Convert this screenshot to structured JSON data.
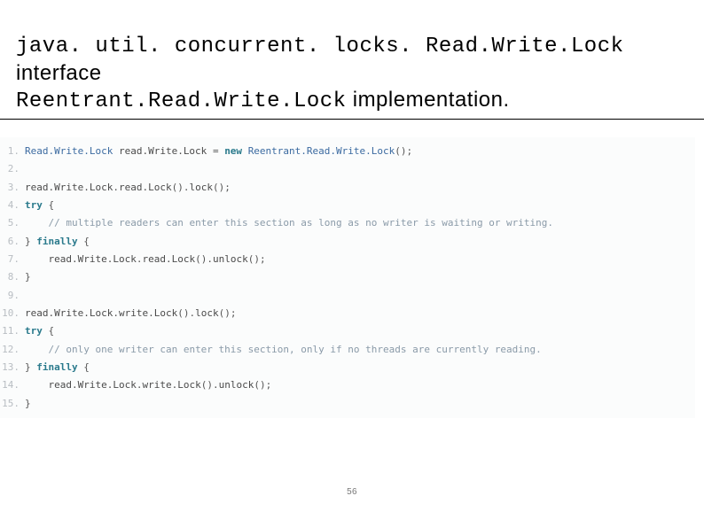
{
  "header": {
    "line1_mono": "java. util. concurrent. locks. Read.Write.Lock",
    "line1_tail": " interface",
    "line2_mono": "Reentrant.Read.Write.Lock",
    "line2_tail": " implementation."
  },
  "code": {
    "lines": [
      {
        "n": "1.",
        "segs": [
          {
            "t": "Read.Write.Lock",
            "c": "tok-type"
          },
          {
            "t": " read.Write.Lock "
          },
          {
            "t": "=",
            "c": "tok-punc"
          },
          {
            "t": " "
          },
          {
            "t": "new",
            "c": "tok-kw"
          },
          {
            "t": " "
          },
          {
            "t": "Reentrant.Read.Write.Lock",
            "c": "tok-type"
          },
          {
            "t": "();",
            "c": "tok-punc"
          }
        ]
      },
      {
        "n": "2.",
        "segs": [
          {
            "t": ""
          }
        ]
      },
      {
        "n": "3.",
        "segs": [
          {
            "t": "read.Write.Lock"
          },
          {
            "t": ".",
            "c": "tok-punc"
          },
          {
            "t": "read.Lock"
          },
          {
            "t": "().",
            "c": "tok-punc"
          },
          {
            "t": "lock"
          },
          {
            "t": "();",
            "c": "tok-punc"
          }
        ]
      },
      {
        "n": "4.",
        "segs": [
          {
            "t": "try",
            "c": "tok-kw"
          },
          {
            "t": " "
          },
          {
            "t": "{",
            "c": "tok-punc"
          }
        ]
      },
      {
        "n": "5.",
        "segs": [
          {
            "t": "    "
          },
          {
            "t": "// multiple readers can enter this section as long as no writer is waiting or writing.",
            "c": "tok-comment"
          }
        ]
      },
      {
        "n": "6.",
        "segs": [
          {
            "t": "}",
            "c": "tok-punc"
          },
          {
            "t": " "
          },
          {
            "t": "finally",
            "c": "tok-kw"
          },
          {
            "t": " "
          },
          {
            "t": "{",
            "c": "tok-punc"
          }
        ]
      },
      {
        "n": "7.",
        "segs": [
          {
            "t": "    read.Write.Lock"
          },
          {
            "t": ".",
            "c": "tok-punc"
          },
          {
            "t": "read.Lock"
          },
          {
            "t": "().",
            "c": "tok-punc"
          },
          {
            "t": "unlock"
          },
          {
            "t": "();",
            "c": "tok-punc"
          }
        ]
      },
      {
        "n": "8.",
        "segs": [
          {
            "t": "}",
            "c": "tok-punc"
          }
        ]
      },
      {
        "n": "9.",
        "segs": [
          {
            "t": ""
          }
        ]
      },
      {
        "n": "10.",
        "segs": [
          {
            "t": "read.Write.Lock"
          },
          {
            "t": ".",
            "c": "tok-punc"
          },
          {
            "t": "write.Lock"
          },
          {
            "t": "().",
            "c": "tok-punc"
          },
          {
            "t": "lock"
          },
          {
            "t": "();",
            "c": "tok-punc"
          }
        ]
      },
      {
        "n": "11.",
        "segs": [
          {
            "t": "try",
            "c": "tok-kw"
          },
          {
            "t": " "
          },
          {
            "t": "{",
            "c": "tok-punc"
          }
        ]
      },
      {
        "n": "12.",
        "segs": [
          {
            "t": "    "
          },
          {
            "t": "// only one writer can enter this section, only if no threads are currently reading.",
            "c": "tok-comment"
          }
        ]
      },
      {
        "n": "13.",
        "segs": [
          {
            "t": "}",
            "c": "tok-punc"
          },
          {
            "t": " "
          },
          {
            "t": "finally",
            "c": "tok-kw"
          },
          {
            "t": " "
          },
          {
            "t": "{",
            "c": "tok-punc"
          }
        ]
      },
      {
        "n": "14.",
        "segs": [
          {
            "t": "    read.Write.Lock"
          },
          {
            "t": ".",
            "c": "tok-punc"
          },
          {
            "t": "write.Lock"
          },
          {
            "t": "().",
            "c": "tok-punc"
          },
          {
            "t": "unlock"
          },
          {
            "t": "();",
            "c": "tok-punc"
          }
        ]
      },
      {
        "n": "15.",
        "segs": [
          {
            "t": "}",
            "c": "tok-punc"
          }
        ]
      }
    ]
  },
  "page_number": "56"
}
